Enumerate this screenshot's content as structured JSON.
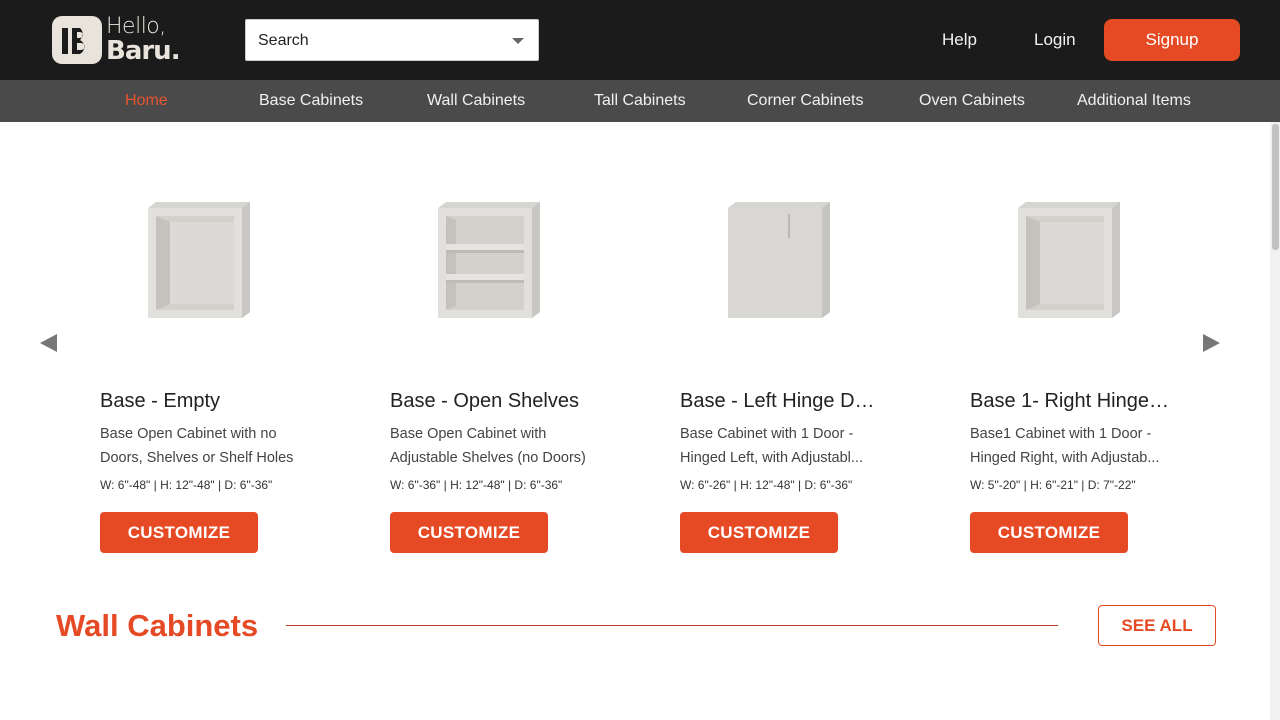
{
  "header": {
    "logo_hello": "Hello,",
    "logo_baru": "Baru.",
    "search_text": "Search",
    "help": "Help",
    "login": "Login",
    "signup": "Signup"
  },
  "nav": {
    "items": [
      {
        "label": "Home",
        "active": true
      },
      {
        "label": "Base Cabinets"
      },
      {
        "label": "Wall Cabinets"
      },
      {
        "label": "Tall Cabinets"
      },
      {
        "label": "Corner Cabinets"
      },
      {
        "label": "Oven Cabinets"
      },
      {
        "label": "Additional Items"
      }
    ]
  },
  "cards": [
    {
      "title": "Base - Empty",
      "desc_line1": "Base Open Cabinet with no",
      "desc_line2": "Doors, Shelves or Shelf Holes",
      "dims": "W: 6\"-48\" | H: 12\"-48\" | D: 6\"-36\"",
      "button": "CUSTOMIZE",
      "icon": "cabinet-empty"
    },
    {
      "title": "Base - Open Shelves",
      "desc_line1": "Base Open Cabinet with",
      "desc_line2": "Adjustable Shelves (no Doors)",
      "dims": "W: 6\"-36\" | H: 12\"-48\" | D: 6\"-36\"",
      "button": "CUSTOMIZE",
      "icon": "cabinet-shelves"
    },
    {
      "title": "Base - Left Hinge Door",
      "desc_line1": "Base Cabinet with 1 Door -",
      "desc_line2": "Hinged Left, with Adjustabl...",
      "dims": "W: 6\"-26\" | H: 12\"-48\" | D: 6\"-36\"",
      "button": "CUSTOMIZE",
      "icon": "cabinet-door"
    },
    {
      "title": "Base 1- Right Hinge ...",
      "desc_line1": "Base1 Cabinet with 1 Door -",
      "desc_line2": "Hinged Right, with Adjustab...",
      "dims": "W: 5\"-20\" | H: 6\"-21\" | D: 7\"-22\"",
      "button": "CUSTOMIZE",
      "icon": "cabinet-empty"
    }
  ],
  "section": {
    "title": "Wall Cabinets",
    "see_all": "SEE ALL"
  },
  "colors": {
    "accent": "#e64a25",
    "header_bg": "#1b1b1b",
    "nav_bg": "#4a4a4a"
  }
}
